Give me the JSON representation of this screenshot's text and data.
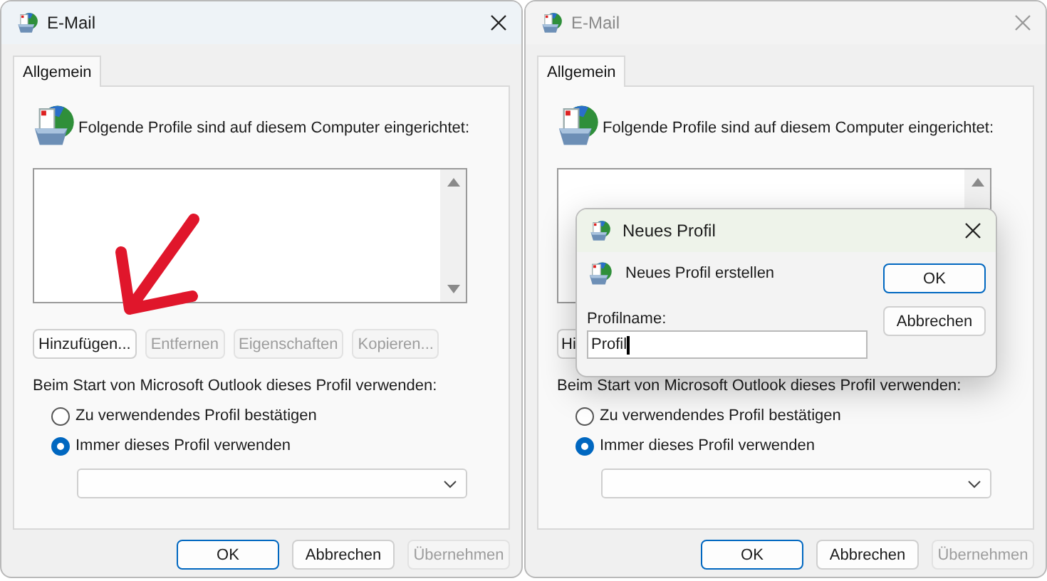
{
  "windows": [
    {
      "title": "E-Mail",
      "active": true,
      "tabs": [
        {
          "label": "Allgemein",
          "selected": true
        }
      ],
      "intro": "Folgende Profile sind auf diesem Computer eingerichtet:",
      "profile_buttons": [
        {
          "label": "Hinzufügen...",
          "disabled": false
        },
        {
          "label": "Entfernen",
          "disabled": true
        },
        {
          "label": "Eigenschaften",
          "disabled": true
        },
        {
          "label": "Kopieren...",
          "disabled": true
        }
      ],
      "startup_label": "Beim Start von Microsoft Outlook dieses Profil verwenden:",
      "options": [
        {
          "label": "Zu verwendendes Profil bestätigen",
          "selected": false
        },
        {
          "label": "Immer dieses Profil verwenden",
          "selected": true
        }
      ],
      "footer_buttons": [
        {
          "label": "OK",
          "default": true,
          "disabled": false
        },
        {
          "label": "Abbrechen",
          "default": false,
          "disabled": false
        },
        {
          "label": "Übernehmen",
          "default": false,
          "disabled": true
        }
      ],
      "annotation": {
        "kind": "arrow"
      }
    },
    {
      "title": "E-Mail",
      "active": false,
      "tabs": [
        {
          "label": "Allgemein",
          "selected": true
        }
      ],
      "intro": "Folgende Profile sind auf diesem Computer eingerichtet:",
      "profile_buttons": [
        {
          "label": "Hi",
          "disabled": false
        }
      ],
      "startup_label": "Beim Start von Microsoft Outlook dieses Profil verwenden:",
      "options": [
        {
          "label": "Zu verwendendes Profil bestätigen",
          "selected": false
        },
        {
          "label": "Immer dieses Profil verwenden",
          "selected": true
        }
      ],
      "footer_buttons": [
        {
          "label": "OK",
          "default": true,
          "disabled": false
        },
        {
          "label": "Abbrechen",
          "default": false,
          "disabled": false
        },
        {
          "label": "Übernehmen",
          "default": false,
          "disabled": true
        }
      ],
      "dialog": {
        "title": "Neues Profil",
        "heading": "Neues Profil erstellen",
        "field_label": "Profilname:",
        "value": "Profil",
        "buttons": [
          {
            "label": "OK",
            "default": true
          },
          {
            "label": "Abbrechen",
            "default": false
          }
        ]
      }
    }
  ]
}
